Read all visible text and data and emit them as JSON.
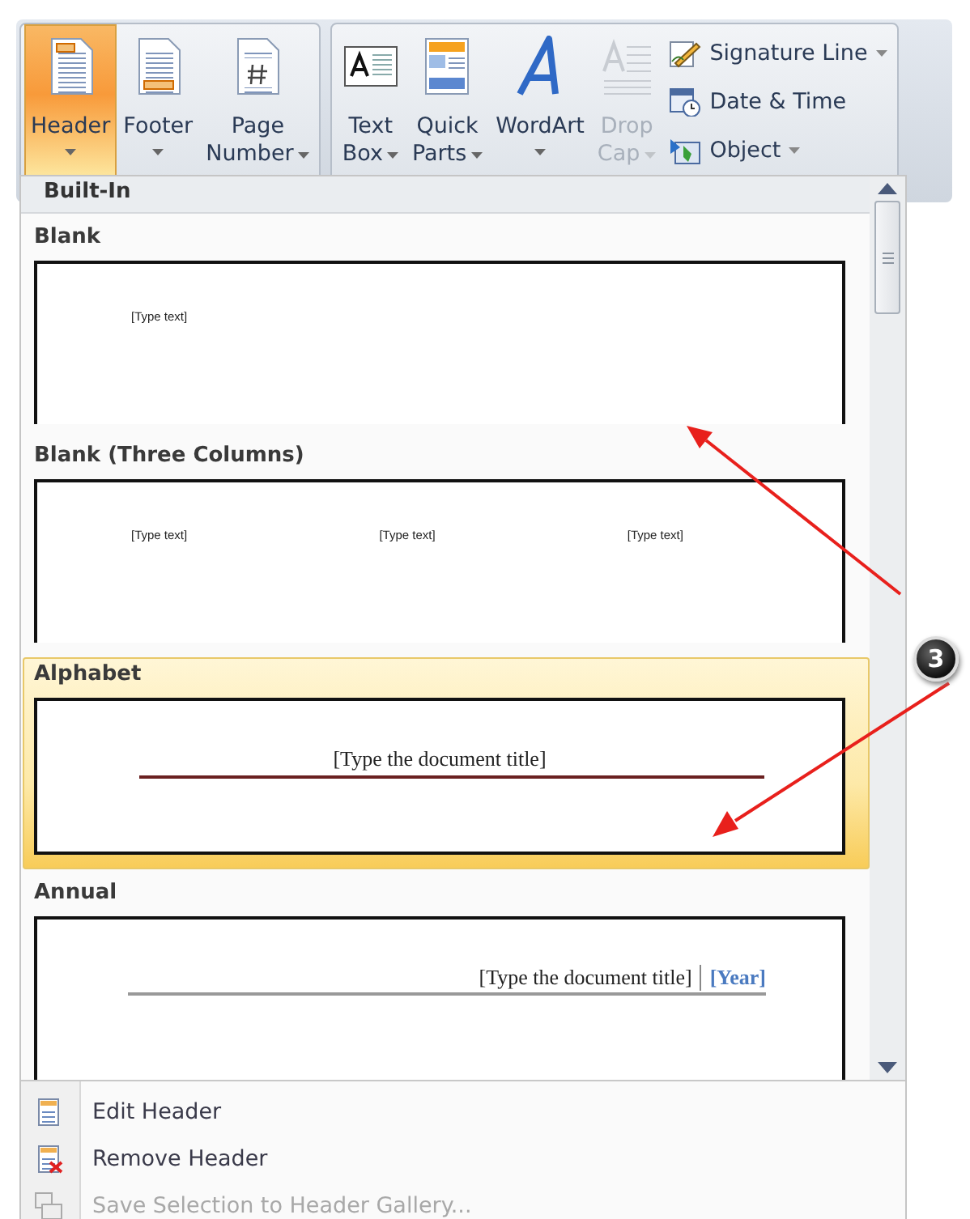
{
  "ribbon": {
    "groups": [
      {
        "buttons": [
          {
            "label": [
              "Header"
            ],
            "selected": true,
            "disabled": false,
            "dropdown": true
          },
          {
            "label": [
              "Footer"
            ],
            "selected": false,
            "disabled": false,
            "dropdown": true
          },
          {
            "label": [
              "Page",
              "Number"
            ],
            "selected": false,
            "disabled": false,
            "dropdown": true
          }
        ]
      },
      {
        "buttons": [
          {
            "label": [
              "Text",
              "Box"
            ],
            "selected": false,
            "disabled": false,
            "dropdown": true
          },
          {
            "label": [
              "Quick",
              "Parts"
            ],
            "selected": false,
            "disabled": false,
            "dropdown": true
          },
          {
            "label": [
              "WordArt"
            ],
            "selected": false,
            "disabled": false,
            "dropdown": true
          },
          {
            "label": [
              "Drop",
              "Cap"
            ],
            "selected": false,
            "disabled": true,
            "dropdown": true
          }
        ],
        "small_buttons": [
          {
            "label": "Signature Line",
            "dropdown": true
          },
          {
            "label": "Date & Time",
            "dropdown": false
          },
          {
            "label": "Object",
            "dropdown": true
          }
        ]
      }
    ]
  },
  "gallery": {
    "section": "Built-In",
    "items": [
      {
        "name": "Blank",
        "kind": "blank",
        "selected": false,
        "texts": [
          "[Type text]"
        ]
      },
      {
        "name": "Blank (Three Columns)",
        "kind": "three_columns",
        "selected": false,
        "texts": [
          "[Type text]",
          "[Type text]",
          "[Type text]"
        ]
      },
      {
        "name": "Alphabet",
        "kind": "alphabet",
        "selected": true,
        "texts": [
          "[Type the document title]"
        ]
      },
      {
        "name": "Annual",
        "kind": "annual",
        "selected": false,
        "texts": [
          "[Type the document title]",
          "[Year]"
        ]
      }
    ]
  },
  "menu": [
    {
      "label": "Edit Header",
      "disabled": false
    },
    {
      "label": "Remove Header",
      "disabled": false
    },
    {
      "label": "Save Selection to Header Gallery...",
      "disabled": true
    }
  ],
  "callout": {
    "number": "3"
  }
}
